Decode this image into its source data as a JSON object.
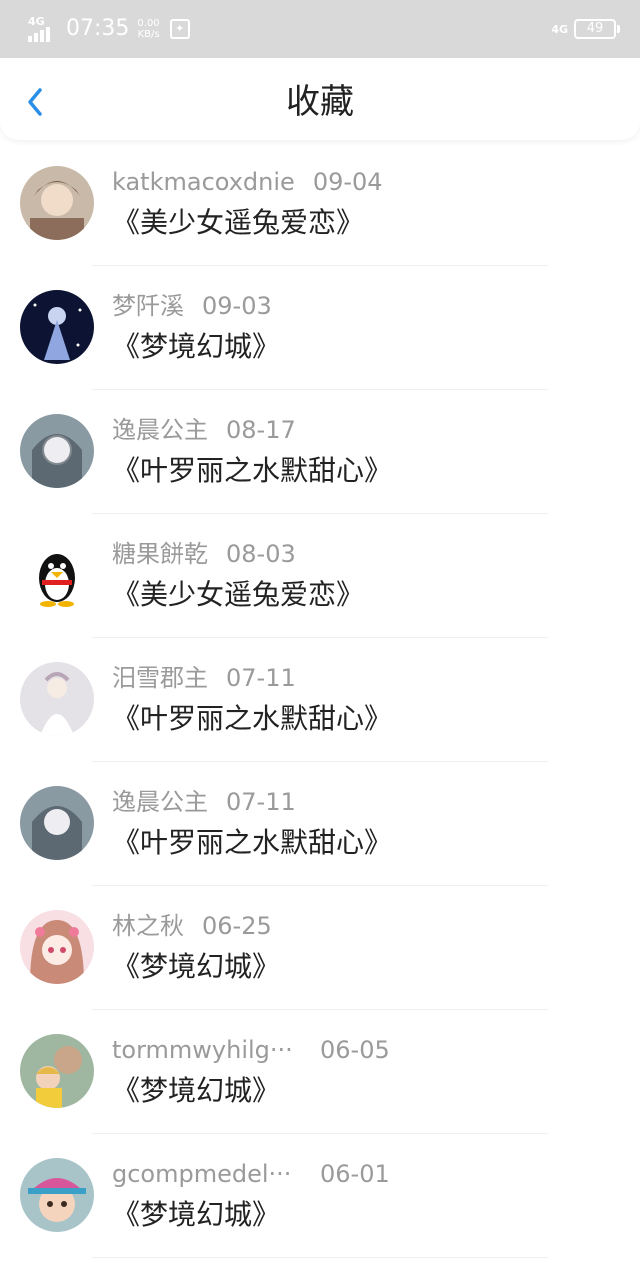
{
  "status_bar": {
    "network_left": "4G",
    "time": "07:35",
    "speed_value": "0.00",
    "speed_unit": "KB/s",
    "network_right": "4G",
    "battery": "49"
  },
  "header": {
    "title": "收藏",
    "back_icon": "chevron-left-icon",
    "accent_color": "#2b8fe8"
  },
  "favorites": [
    {
      "user": "katkmacoxdnie",
      "date": "09-04",
      "title": "《美少女遥兔爱恋》"
    },
    {
      "user": "梦阡溪",
      "date": "09-03",
      "title": "《梦境幻城》"
    },
    {
      "user": "逸晨公主",
      "date": "08-17",
      "title": "《叶罗丽之水默甜心》"
    },
    {
      "user": "糖果餅乾",
      "date": "08-03",
      "title": "《美少女遥兔爱恋》"
    },
    {
      "user": "汨雪郡主",
      "date": "07-11",
      "title": "《叶罗丽之水默甜心》"
    },
    {
      "user": "逸晨公主",
      "date": "07-11",
      "title": "《叶罗丽之水默甜心》"
    },
    {
      "user": "林之秋",
      "date": "06-25",
      "title": "《梦境幻城》"
    },
    {
      "user": "tormmwyhilg···",
      "date": "06-05",
      "title": "《梦境幻城》"
    },
    {
      "user": "gcompmedel···",
      "date": "06-01",
      "title": "《梦境幻城》"
    }
  ]
}
